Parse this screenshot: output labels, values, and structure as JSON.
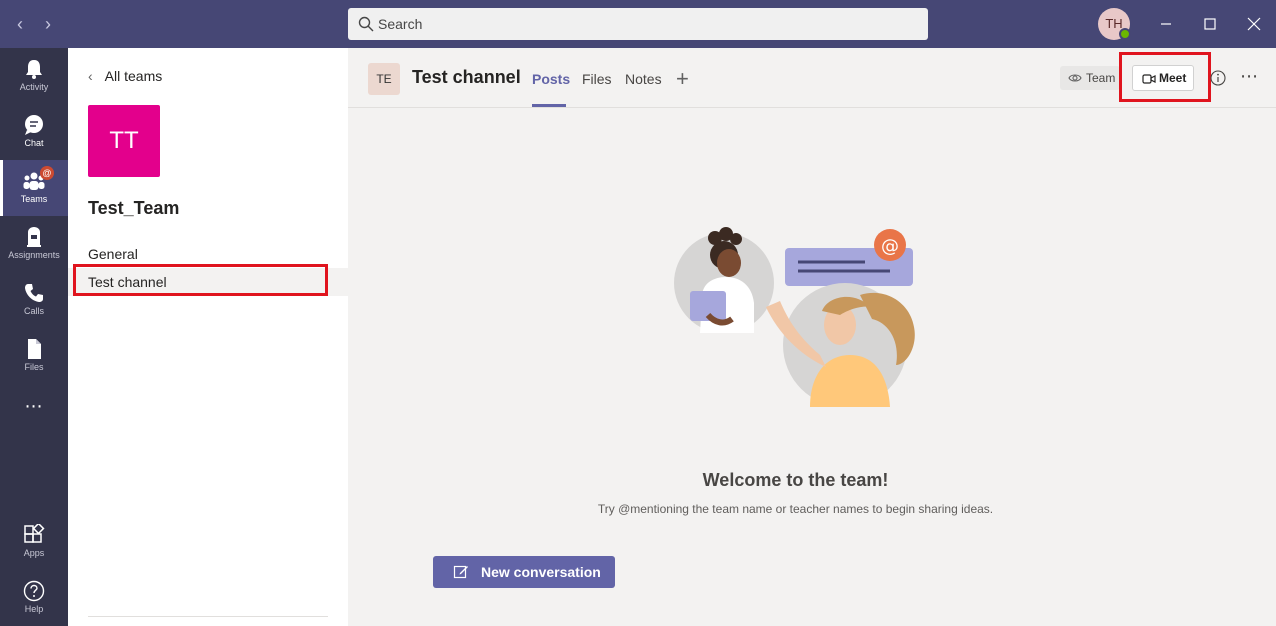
{
  "titlebar": {
    "search_placeholder": "Search",
    "user_initials": "TH"
  },
  "rail": {
    "items": [
      {
        "label": "Activity",
        "icon": "bell-icon"
      },
      {
        "label": "Chat",
        "icon": "chat-icon"
      },
      {
        "label": "Teams",
        "icon": "teams-icon",
        "active": true,
        "badge": "@"
      },
      {
        "label": "Assignments",
        "icon": "assignments-icon"
      },
      {
        "label": "Calls",
        "icon": "phone-icon"
      },
      {
        "label": "Files",
        "icon": "file-icon"
      },
      {
        "label": "...",
        "icon": "more-apps-icon"
      },
      {
        "label": "Apps",
        "icon": "apps-icon"
      },
      {
        "label": "Help",
        "icon": "help-icon"
      }
    ]
  },
  "panel": {
    "back_label": "All teams",
    "team_initials": "TT",
    "team_name": "Test_Team",
    "channels": [
      "General",
      "Test channel"
    ],
    "selected_channel": "Test channel"
  },
  "header": {
    "channel_initials": "TE",
    "channel_title": "Test channel",
    "tabs": [
      "Posts",
      "Files",
      "Notes"
    ],
    "active_tab": "Posts",
    "team_label": "Team",
    "meet_label": "Meet"
  },
  "welcome": {
    "title": "Welcome to the team!",
    "subtitle": "Try @mentioning the team name or teacher names to begin sharing ideas.",
    "new_conversation_label": "New conversation"
  },
  "colors": {
    "titlebar": "#464775",
    "rail": "#33344a",
    "accent": "#6264a7",
    "team_tile": "#e3008c",
    "highlight_box": "#e0141e"
  }
}
